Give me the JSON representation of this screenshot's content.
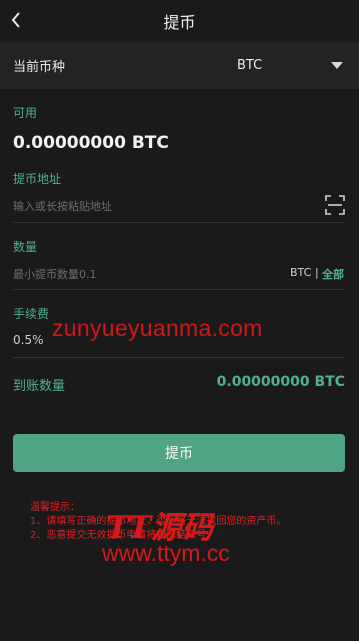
{
  "header": {
    "title": "提币"
  },
  "coin": {
    "label": "当前币种",
    "value": "BTC"
  },
  "available": {
    "label": "可用",
    "amount": "0.00000000 BTC"
  },
  "address": {
    "label": "提币地址",
    "placeholder": "输入或长按粘贴地址"
  },
  "quantity": {
    "label": "数量",
    "placeholder": "最小提币数量0.1",
    "unit": "BTC",
    "separator": "|",
    "all": "全部"
  },
  "fee": {
    "label": "手续费",
    "value": "0.5%"
  },
  "arrival": {
    "label": "到账数量",
    "value": "0.00000000 BTC"
  },
  "submit_label": "提币",
  "tips": {
    "title": "温馨提示：",
    "line1": "1、请填写正确的提币地址，否则将无法找回您的资产币。",
    "line2": "2、恶意提交无效提币申请将被冻结账号。"
  },
  "watermark": {
    "domain": "zunyueyuanma.com",
    "brand": "TT源码",
    "site": "www.ttym.cc"
  },
  "colors": {
    "accent": "#4fa583",
    "background": "#1a1a1a",
    "warning": "#e02020"
  },
  "icons": {
    "back": "chevron-left-icon",
    "dropdown": "caret-down-icon",
    "scan": "scan-icon"
  }
}
